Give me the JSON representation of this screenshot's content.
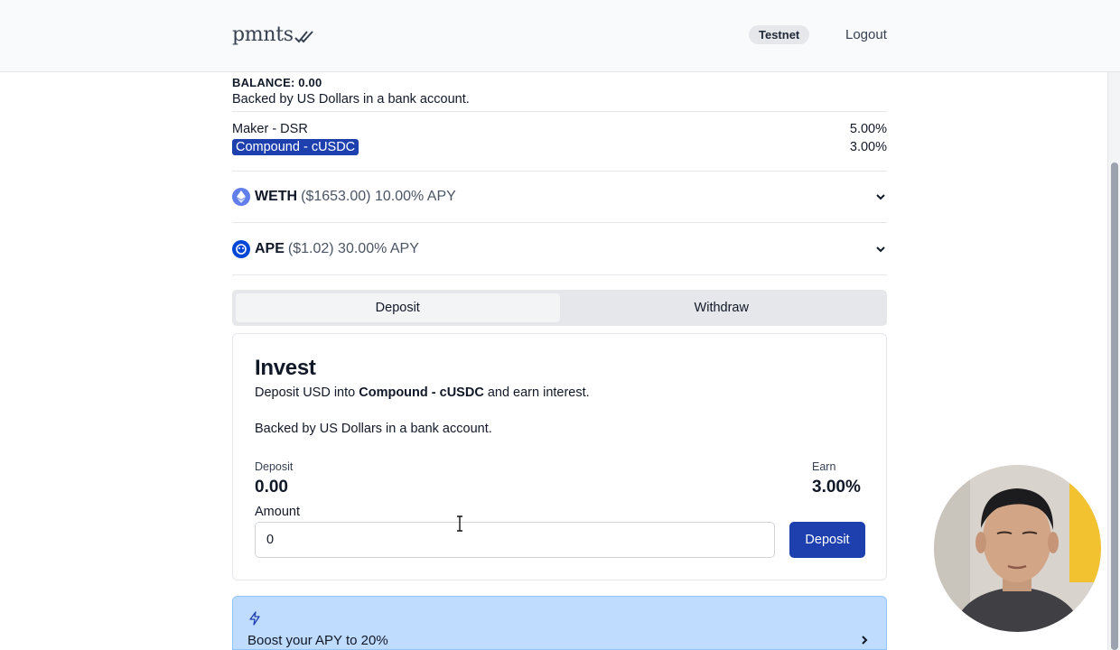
{
  "header": {
    "logo_text": "pmnts",
    "network_badge": "Testnet",
    "logout_label": "Logout"
  },
  "balance": {
    "label": "BALANCE: 0.00",
    "description": "Backed by US Dollars in a bank account."
  },
  "rates": [
    {
      "name": "Maker - DSR",
      "value": "5.00%",
      "selected": false
    },
    {
      "name": "Compound - cUSDC",
      "value": "3.00%",
      "selected": true
    }
  ],
  "assets": [
    {
      "symbol": "WETH",
      "detail": "($1653.00) 10.00% APY",
      "icon": "ethereum-icon",
      "color": "#627eea"
    },
    {
      "symbol": "APE",
      "detail": "($1.02) 30.00% APY",
      "icon": "apecoin-icon",
      "color": "#0047d6"
    }
  ],
  "tabs": [
    {
      "label": "Deposit",
      "active": true
    },
    {
      "label": "Withdraw",
      "active": false
    }
  ],
  "invest": {
    "title": "Invest",
    "desc_prefix": "Deposit USD into ",
    "desc_bold": "Compound - cUSDC",
    "desc_suffix": " and earn interest.",
    "backing": "Backed by US Dollars in a bank account.",
    "deposit_label": "Deposit",
    "deposit_value": "0.00",
    "earn_label": "Earn",
    "earn_value": "3.00%",
    "amount_label": "Amount",
    "amount_value": "0",
    "submit_label": "Deposit"
  },
  "boost": {
    "label": "Boost your APY to 20%",
    "icon": "lightning-icon"
  },
  "colors": {
    "primary": "#1e40af",
    "boost_bg": "#bfdbfe"
  }
}
